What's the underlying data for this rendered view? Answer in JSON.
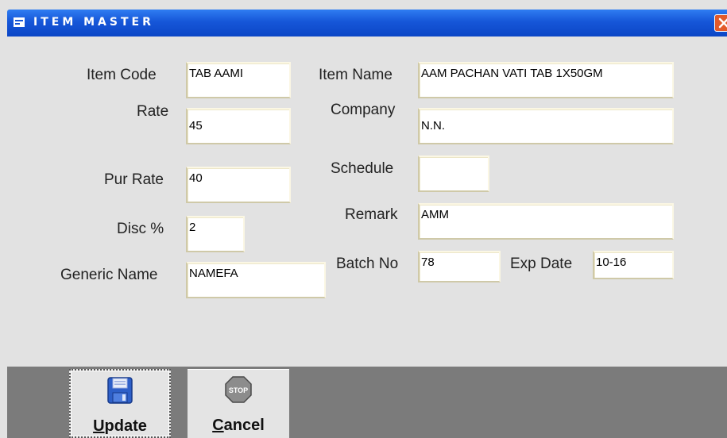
{
  "window": {
    "title": "ITEM MASTER"
  },
  "form": {
    "item_code": {
      "label": "Item Code",
      "value": "TAB AAMI"
    },
    "item_name": {
      "label": "Item Name",
      "value": "AAM PACHAN VATI TAB 1X50GM"
    },
    "rate": {
      "label": "Rate",
      "value": "45"
    },
    "company": {
      "label": "Company",
      "value": "N.N."
    },
    "schedule": {
      "label": "Schedule",
      "value": ""
    },
    "pur_rate": {
      "label": "Pur Rate",
      "value": "40"
    },
    "remark": {
      "label": "Remark",
      "value": "AMM"
    },
    "disc": {
      "label": "Disc %",
      "value": "2"
    },
    "generic_name": {
      "label": "Generic Name",
      "value": "NAMEFA"
    },
    "batch_no": {
      "label": "Batch No",
      "value": "78"
    },
    "exp_date": {
      "label": "Exp Date",
      "value": "10-16"
    }
  },
  "toolbar": {
    "update": {
      "hotkey": "U",
      "rest": "pdate",
      "icon": "floppy-disk-icon"
    },
    "cancel": {
      "hotkey": "C",
      "rest": "ancel",
      "icon": "stop-sign-icon",
      "icon_text": "STOP"
    }
  },
  "colors": {
    "titlebar": "#0b46c6",
    "panel": "#e2e2e2",
    "bottombar": "#7b7b7b",
    "close": "#e35a2a"
  }
}
